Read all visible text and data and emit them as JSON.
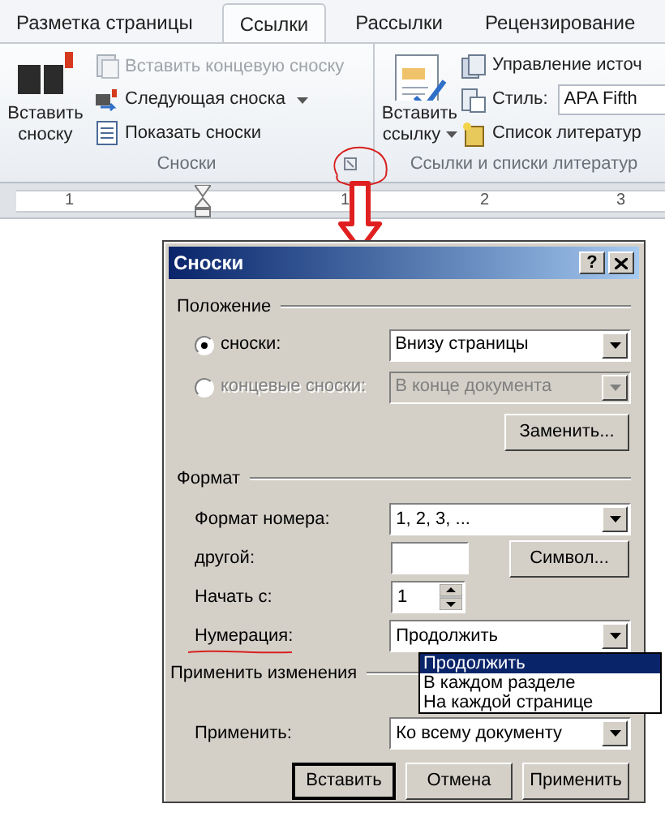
{
  "tabs": [
    {
      "label": "Разметка страницы",
      "selected": false
    },
    {
      "label": "Ссылки",
      "selected": true
    },
    {
      "label": "Рассылки",
      "selected": false
    },
    {
      "label": "Рецензирование",
      "selected": false
    }
  ],
  "ribbon_groups": [
    {
      "title": "Сноски",
      "large_button": {
        "label": "Вставить сноску",
        "dropdown": false
      },
      "items": [
        {
          "kind": "button",
          "label": "Вставить концевую сноску",
          "disabled": true,
          "dropdown": false
        },
        {
          "kind": "button",
          "label": "Следующая сноска",
          "disabled": false,
          "dropdown": true
        },
        {
          "kind": "button",
          "label": "Показать сноски",
          "disabled": false,
          "dropdown": false
        }
      ]
    },
    {
      "title": "Ссылки и списки литератур",
      "large_button": {
        "label": "Вставить ссылку",
        "dropdown": true
      },
      "items": [
        {
          "kind": "button",
          "label": "Управление источ",
          "disabled": false,
          "dropdown": false
        },
        {
          "kind": "style",
          "label": "Стиль:",
          "value": "APA Fifth",
          "disabled": false
        },
        {
          "kind": "button",
          "label": "Список литератур",
          "disabled": false,
          "dropdown": false
        }
      ]
    }
  ],
  "ruler": {
    "numbers": [
      "1",
      "1",
      "2",
      "3"
    ]
  },
  "dialog": {
    "title": "Сноски",
    "help": "?",
    "position": {
      "title": "Положение",
      "options": [
        {
          "label": "сноски:",
          "selected": true,
          "disabled": false,
          "value": "Внизу страницы"
        },
        {
          "label": "концевые сноски:",
          "selected": false,
          "disabled": true,
          "value": "В конце документа"
        }
      ],
      "convert_button": "Заменить..."
    },
    "format": {
      "title": "Формат",
      "number_format": {
        "label": "Формат номера:",
        "value": "1, 2, 3, ..."
      },
      "custom_mark": {
        "label": "другой:",
        "button": "Символ..."
      },
      "start_at": {
        "label": "Начать с:",
        "value": "1"
      },
      "numbering": {
        "label": "Нумерация:",
        "value": "Продолжить",
        "options": [
          {
            "label": "Продолжить",
            "selected": true
          },
          {
            "label": "В каждом разделе",
            "selected": false
          },
          {
            "label": "На каждой странице",
            "selected": false
          }
        ]
      }
    },
    "apply_changes": {
      "title": "Применить изменения",
      "apply_to": {
        "label": "Применить:",
        "value": "Ко всему документу"
      }
    },
    "buttons": [
      {
        "label": "Вставить",
        "default": true
      },
      {
        "label": "Отмена",
        "default": false
      },
      {
        "label": "Применить",
        "default": false
      }
    ]
  }
}
